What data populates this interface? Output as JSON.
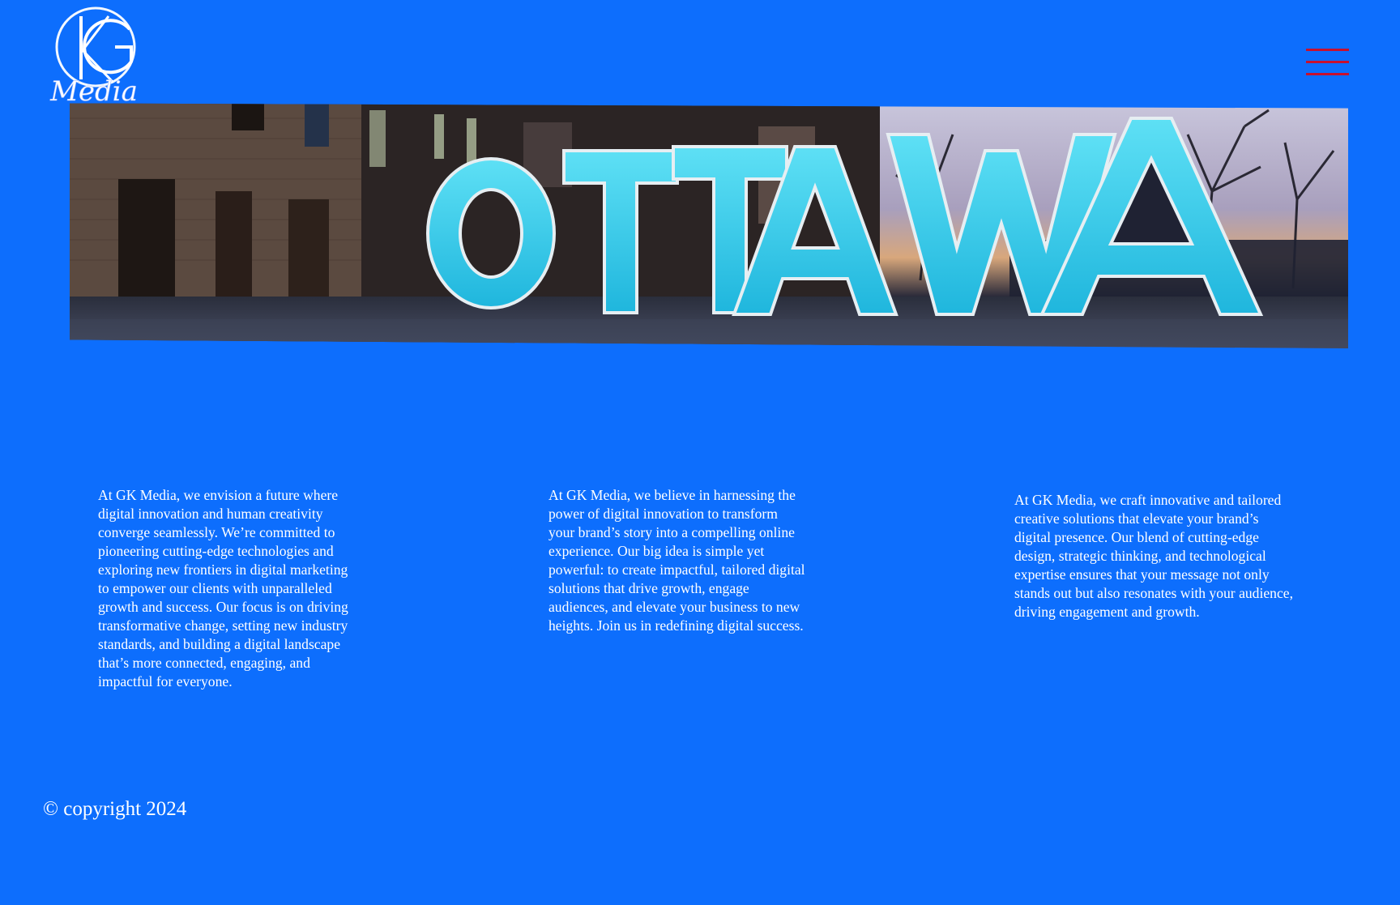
{
  "brand": {
    "logo_text": "Media",
    "logo_monogram": "GK",
    "logo_icon": "gk-media-logo"
  },
  "header": {
    "menu_icon": "hamburger-menu-icon"
  },
  "hero": {
    "sign_text": "OTTAWA"
  },
  "columns": [
    {
      "text": "At GK Media, we envision a future where digital innovation and human creativity converge seamlessly. We’re committed to pioneering cutting-edge technologies and exploring new frontiers in digital marketing to empower our clients with unparalleled growth and success. Our focus is on driving transformative change, setting new industry standards, and building a digital landscape that’s more connected, engaging, and impactful for everyone."
    },
    {
      "text": "At GK Media, we believe in harnessing the power of digital innovation to transform your brand’s story into a compelling online experience. Our big idea is simple yet powerful: to create impactful, tailored digital solutions that drive growth, engage audiences, and elevate your business to new heights. Join us in redefining digital success."
    },
    {
      "text": "At GK Media, we craft innovative and tailored creative solutions that elevate your brand’s digital presence. Our blend of cutting-edge design, strategic thinking, and technological expertise ensures that your message not only stands out but also resonates with your audience, driving engagement and growth."
    }
  ],
  "footer": {
    "copyright": "© copyright 2024"
  },
  "colors": {
    "background": "#0d6efd",
    "text": "#ffffff",
    "menu_accent": "#c8102e",
    "sign_glow": "#3fd0ec"
  }
}
